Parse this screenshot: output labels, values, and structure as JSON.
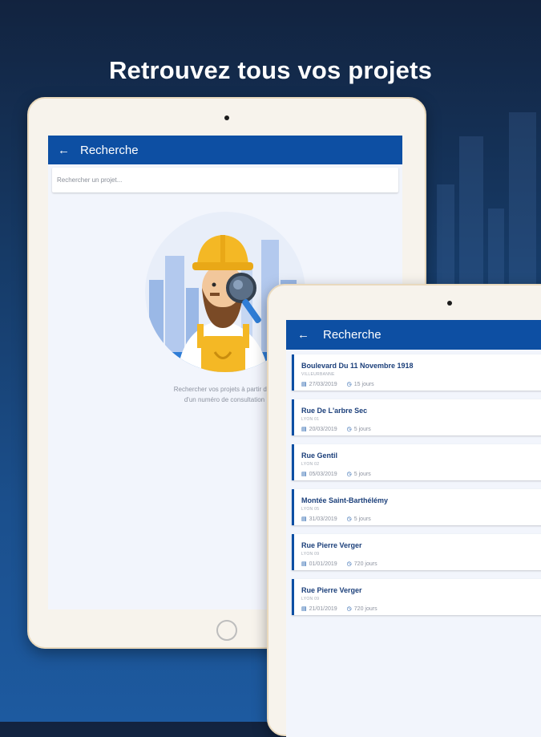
{
  "headline": "Retrouvez tous vos projets",
  "tablet_left": {
    "appbar_title": "Recherche",
    "search_placeholder": "Rechercher un projet...",
    "empty_text_line1": "Rechercher vos projets à partir d'un",
    "empty_text_line2": "d'un numéro de consultation"
  },
  "tablet_right": {
    "appbar_title": "Recherche",
    "projects": [
      {
        "title": "Boulevard Du 11 Novembre 1918",
        "city": "VILLEURBANNE",
        "date": "27/03/2019",
        "duration": "15 jours"
      },
      {
        "title": "Rue De L'arbre Sec",
        "city": "LYON 01",
        "date": "20/03/2019",
        "duration": "5 jours"
      },
      {
        "title": "Rue Gentil",
        "city": "LYON 02",
        "date": "05/03/2019",
        "duration": "5 jours"
      },
      {
        "title": "Montée Saint-Barthélémy",
        "city": "LYON 05",
        "date": "31/03/2019",
        "duration": "5 jours"
      },
      {
        "title": "Rue Pierre Verger",
        "city": "LYON 09",
        "date": "01/01/2019",
        "duration": "720 jours"
      },
      {
        "title": "Rue Pierre Verger",
        "city": "LYON 09",
        "date": "21/01/2019",
        "duration": "720 jours"
      }
    ]
  },
  "colors": {
    "accent": "#0d4fa3",
    "background_top": "#12233f",
    "background_bottom": "#1d5aa0"
  }
}
